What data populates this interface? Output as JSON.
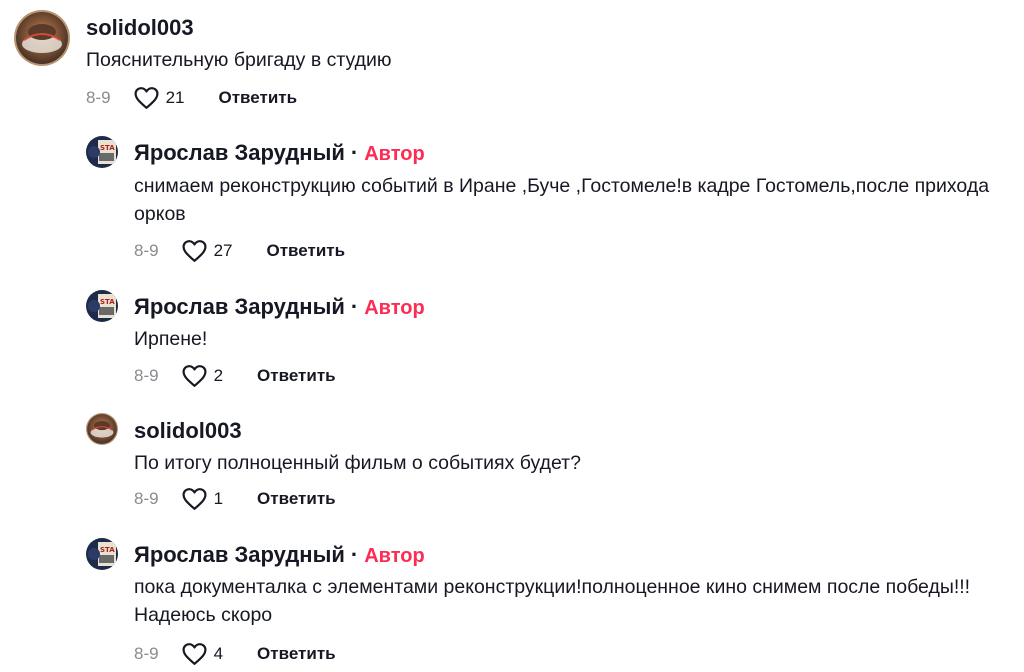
{
  "colors": {
    "author_badge": "#fe2c55",
    "date": "#8a8b91",
    "text": "#161823"
  },
  "icons": {
    "like": "heart-outline-icon"
  },
  "comments": [
    {
      "username": "solidol003",
      "is_author": false,
      "text": "Пояснительную бригаду в студию",
      "date": "8-9",
      "likes": "21",
      "reply_label": "Ответить"
    },
    {
      "username": "Ярослав Зарудный",
      "separator": "·",
      "is_author": true,
      "author_badge": "Автор",
      "text": "снимаем реконструкцию событий в Иране ,Буче ,Гостомеле!в кадре Гостомель,после прихода орков",
      "date": "8-9",
      "likes": "27",
      "reply_label": "Ответить"
    },
    {
      "username": "Ярослав Зарудный",
      "separator": "·",
      "is_author": true,
      "author_badge": "Автор",
      "text": "Ирпене!",
      "date": "8-9",
      "likes": "2",
      "reply_label": "Ответить"
    },
    {
      "username": "solidol003",
      "is_author": false,
      "text": "По итогу полноценный фильм о событиях будет?",
      "date": "8-9",
      "likes": "1",
      "reply_label": "Ответить"
    },
    {
      "username": "Ярослав Зарудный",
      "separator": "·",
      "is_author": true,
      "author_badge": "Автор",
      "text": "пока документалка с элементами реконструкции!полноценное кино снимем после победы!!!Надеюсь скоро",
      "date": "8-9",
      "likes": "4",
      "reply_label": "Ответить"
    }
  ]
}
